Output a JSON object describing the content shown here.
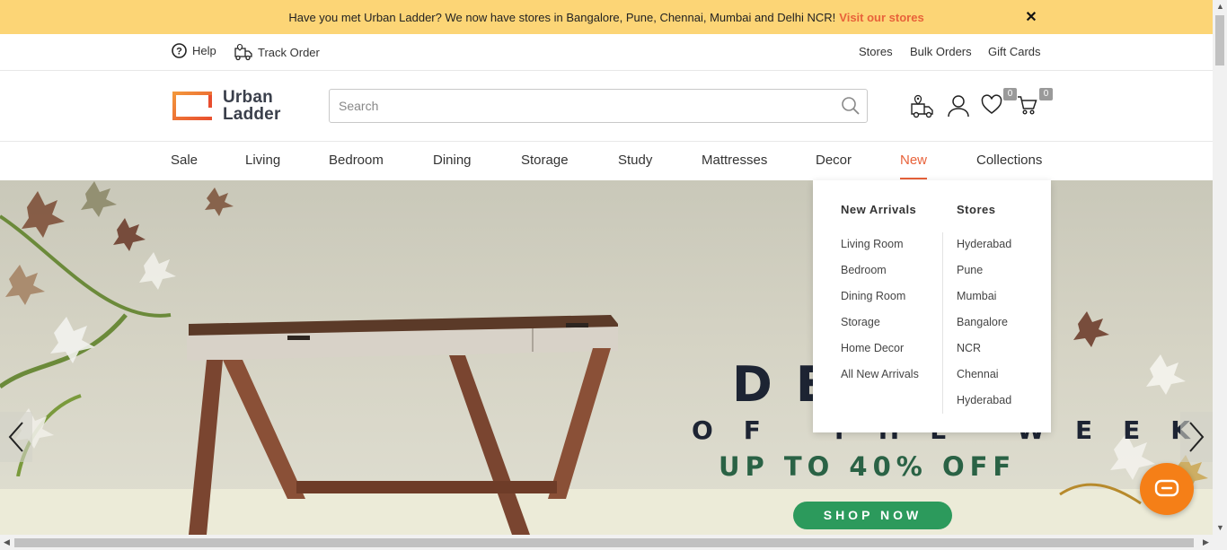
{
  "promo": {
    "text": "Have you met Urban Ladder? We now have stores in Bangalore, Pune, Chennai, Mumbai and Delhi NCR!",
    "link": "Visit our stores",
    "close": "✕"
  },
  "utility": {
    "help": "Help",
    "track_order": "Track Order",
    "stores": "Stores",
    "bulk_orders": "Bulk Orders",
    "gift_cards": "Gift Cards"
  },
  "header": {
    "logo_line1": "Urban",
    "logo_line2": "Ladder",
    "search_placeholder": "Search",
    "wishlist_count": "0",
    "cart_count": "0"
  },
  "nav": {
    "items": [
      "Sale",
      "Living",
      "Bedroom",
      "Dining",
      "Storage",
      "Study",
      "Mattresses",
      "Decor",
      "New",
      "Collections"
    ],
    "active": "New"
  },
  "dropdown": {
    "col1_title": "New Arrivals",
    "col1_links": [
      "Living Room",
      "Bedroom",
      "Dining Room",
      "Storage",
      "Home Decor",
      "All New Arrivals"
    ],
    "col2_title": "Stores",
    "col2_links": [
      "Hyderabad",
      "Pune",
      "Mumbai",
      "Bangalore",
      "NCR",
      "Chennai",
      "Hyderabad"
    ]
  },
  "hero": {
    "title": "DEAL",
    "subtitle": "OF THE WEEK",
    "offer": "UP TO 40% OFF",
    "cta": "SHOP NOW"
  },
  "colors": {
    "accent": "#e8623a",
    "promo_bg": "#fcd576",
    "cta_green": "#2c9a5c",
    "chat_orange": "#f57f17"
  }
}
